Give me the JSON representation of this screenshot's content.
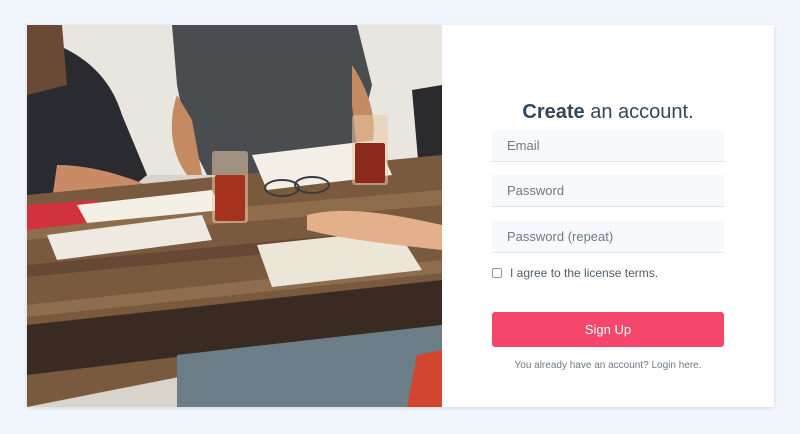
{
  "form": {
    "title_bold": "Create",
    "title_rest": " an account.",
    "email_placeholder": "Email",
    "password_placeholder": "Password",
    "password_repeat_placeholder": "Password (repeat)",
    "terms_label": "I agree to the license terms.",
    "terms_checked": false,
    "submit_label": "Sign Up",
    "login_link": "You already have an account? Login here."
  },
  "colors": {
    "page_background": "#f1f5fc",
    "accent": "#f4476b",
    "title": "#33475b"
  }
}
